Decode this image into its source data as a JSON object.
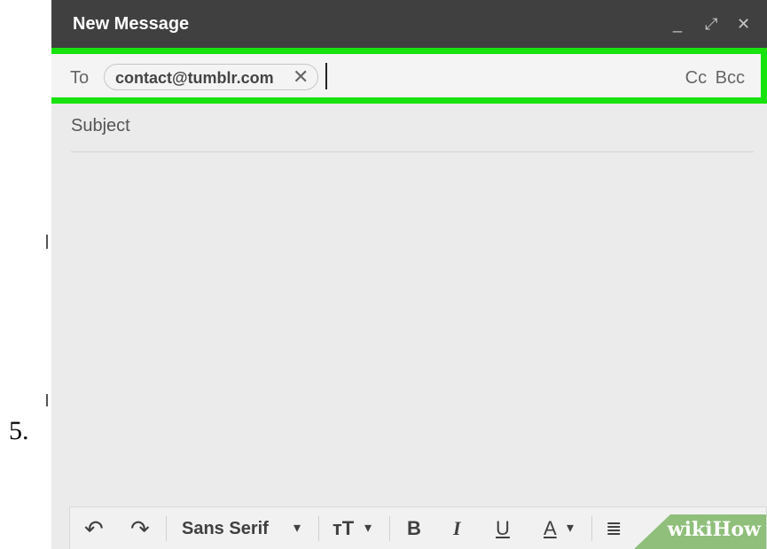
{
  "step": {
    "number": "5."
  },
  "window": {
    "title": "New Message",
    "controls": {
      "minimize": "_",
      "expand": "⤢",
      "close": "✕"
    }
  },
  "to_field": {
    "label": "To",
    "recipient_chip": "contact@tumblr.com",
    "chip_remove_glyph": "✕",
    "cc_bcc": "Cc Bcc",
    "highlight_color": "#17e30e"
  },
  "subject_field": {
    "placeholder": "Subject"
  },
  "toolbar": {
    "undo": "↶",
    "redo": "↷",
    "font_name": "Sans Serif",
    "dropdown_arrow": "▾",
    "text_size": "тT",
    "bold": "B",
    "italic": "I",
    "underline": "U",
    "text_color": "A",
    "align": "≣"
  },
  "watermark": {
    "text": "wikiHow"
  },
  "colors": {
    "titlebar": "#404040",
    "body": "#ebebeb",
    "accent": "#17e30e"
  }
}
